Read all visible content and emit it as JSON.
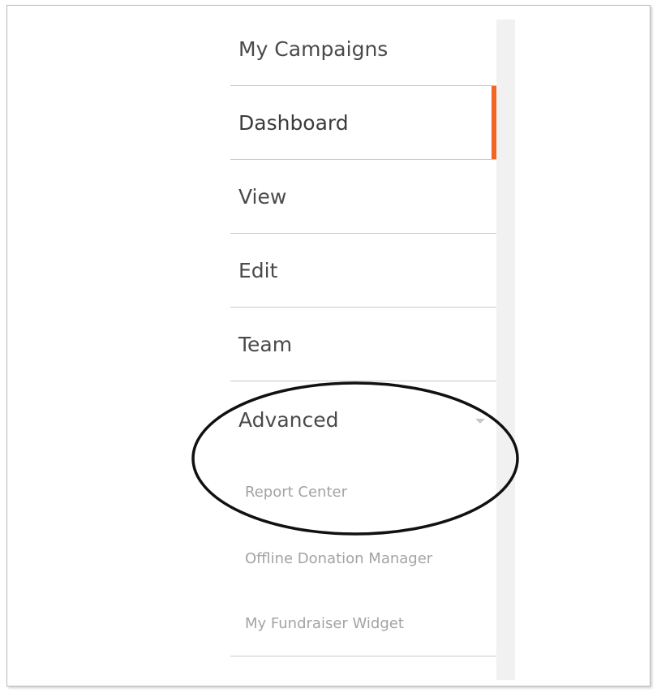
{
  "menu": {
    "items": [
      {
        "label": "My Campaigns"
      },
      {
        "label": "Dashboard",
        "active": true
      },
      {
        "label": "View"
      },
      {
        "label": "Edit"
      },
      {
        "label": "Team"
      }
    ],
    "advanced": {
      "label": "Advanced",
      "icon": "caret-down-icon",
      "sub_items": [
        {
          "label": "Report Center"
        },
        {
          "label": "Offline Donation Manager"
        },
        {
          "label": "My Fundraiser Widget"
        }
      ]
    }
  },
  "colors": {
    "active_indicator": "#f26522",
    "annotation_ellipse": "#111111"
  }
}
